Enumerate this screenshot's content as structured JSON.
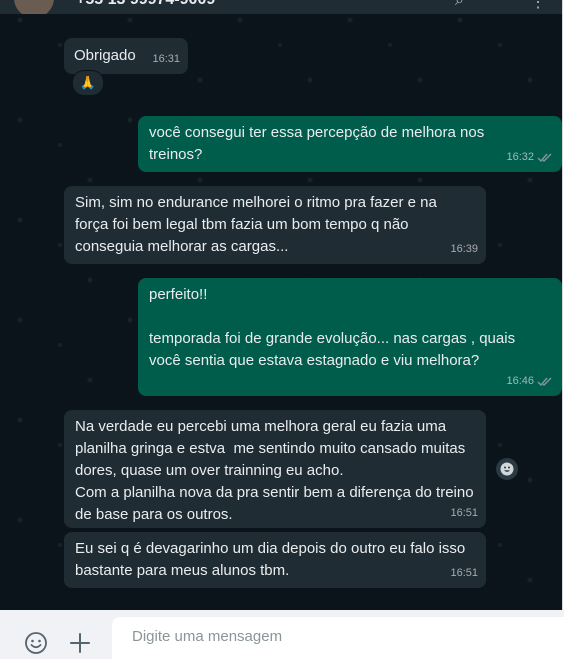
{
  "header": {
    "contact_name": "+55 13 99974-9009"
  },
  "messages": [
    {
      "direction": "in",
      "text": "Obrigado",
      "time": "16:31",
      "reaction": "🙏"
    },
    {
      "direction": "out",
      "text": "você consegui ter essa percepção de melhora nos treinos?",
      "time": "16:32",
      "status": "read"
    },
    {
      "direction": "in",
      "text": "Sim, sim no endurance melhorei o ritmo pra fazer e na força foi bem legal tbm fazia um bom tempo q não conseguia melhorar as cargas...",
      "time": "16:39"
    },
    {
      "direction": "out",
      "text": "perfeito!!\n\ntemporada foi de grande evolução... nas cargas , quais você sentia que estava estagnado e viu melhora?",
      "time": "16:46",
      "status": "read"
    },
    {
      "direction": "in",
      "text": "Na verdade eu percebi uma melhora geral eu fazia uma planilha gringa e estva  me sentindo muito cansado muitas dores, quase um over trainning eu acho.\nCom a planilha nova da pra sentir bem a diferença do treino de base para os outros.",
      "time": "16:51"
    },
    {
      "direction": "in",
      "text": "Eu sei q é devagarinho um dia depois do outro eu falo isso bastante para meus alunos tbm.",
      "time": "16:51"
    }
  ],
  "composer": {
    "placeholder": "Digite uma mensagem"
  },
  "colors": {
    "incoming": "#202c33",
    "outgoing": "#005c4b",
    "background": "#0b141a",
    "read_ticks": "#8696a0"
  },
  "icons": [
    "emoji-icon",
    "plus-icon",
    "smiley-react-icon",
    "read-receipt-icon",
    "search-icon",
    "menu-icon"
  ]
}
